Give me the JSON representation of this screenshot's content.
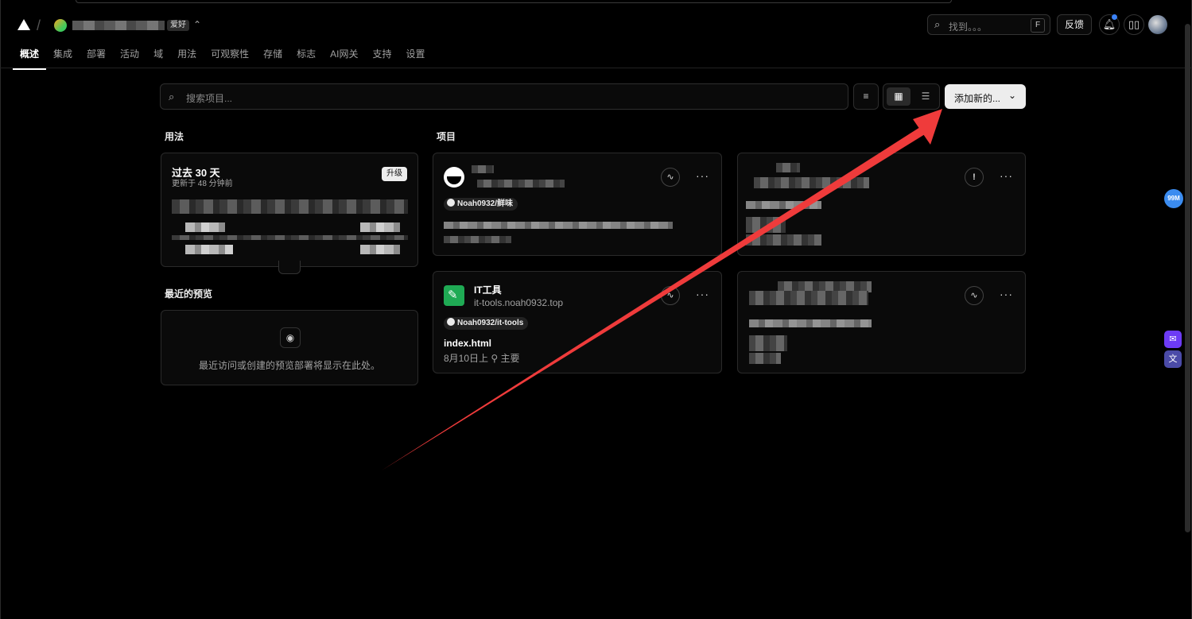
{
  "header": {
    "team_badge": "爱好",
    "search_placeholder": "找到。。。",
    "search_shortcut": "F",
    "feedback_label": "反馈"
  },
  "nav": {
    "tabs": [
      "概述",
      "集成",
      "部署",
      "活动",
      "域",
      "用法",
      "可观察性",
      "存储",
      "标志",
      "AI网关",
      "支持",
      "设置"
    ],
    "active": "概述"
  },
  "toolbar": {
    "search_placeholder": "搜索项目...",
    "add_new_label": "添加新的..."
  },
  "usage": {
    "section_title": "用法",
    "period_title": "过去 30 天",
    "updated": "更新于 48 分钟前",
    "upgrade_label": "升级"
  },
  "previews": {
    "section_title": "最近的预览",
    "empty_text": "最近访问或创建的预览部署将显示在此处。"
  },
  "projects": {
    "section_title": "项目",
    "items": [
      {
        "name": "",
        "url": "",
        "repo": "Noah0932/鲜味",
        "commit": "",
        "meta": "",
        "status_icon": "activity-icon"
      },
      {
        "name": "",
        "url": "",
        "repo": "",
        "commit": "",
        "meta": "",
        "status_icon": "alert-icon"
      },
      {
        "name": "IT工具",
        "url": "it-tools.noah0932.top",
        "repo": "Noah0932/it-tools",
        "commit": "index.html",
        "meta": "8月10日上 ⚲ 主要",
        "status_icon": "activity-icon"
      },
      {
        "name": "",
        "url": "",
        "repo": "",
        "commit": "",
        "meta": "",
        "status_icon": "activity-icon"
      }
    ]
  },
  "side": {
    "badge": "99M"
  },
  "colors": {
    "background": "#000000",
    "card": "#0a0a0a",
    "border": "#2a2a2a",
    "accent": "#3b82f6",
    "arrow": "#ef4444"
  }
}
